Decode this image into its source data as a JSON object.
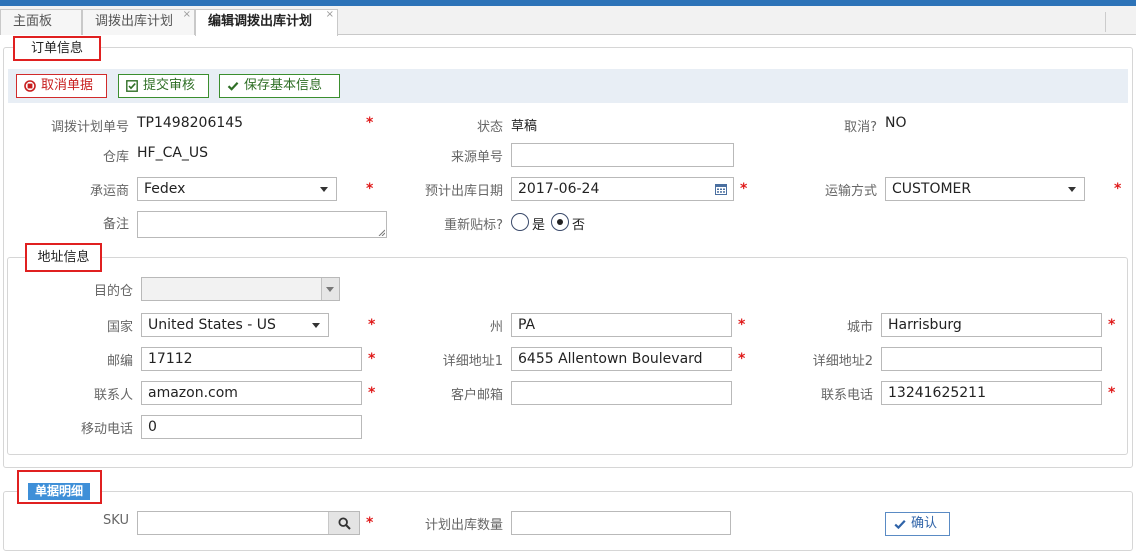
{
  "tabs": [
    {
      "label": "主面板"
    },
    {
      "label": "调拨出库计划",
      "close": "×"
    },
    {
      "label": "编辑调拨出库计划",
      "close": "×"
    }
  ],
  "order_section": {
    "legend": "订单信息",
    "buttons": {
      "cancel": "取消单据",
      "submit": "提交审核",
      "save": "保存基本信息"
    },
    "fields": {
      "plan_no_label": "调拨计划单号",
      "plan_no_value": "TP1498206145",
      "status_label": "状态",
      "status_value": "草稿",
      "cancelled_label": "取消?",
      "cancelled_value": "NO",
      "warehouse_label": "仓库",
      "warehouse_value": "HF_CA_US",
      "source_no_label": "来源单号",
      "source_no_value": "",
      "carrier_label": "承运商",
      "carrier_value": "Fedex",
      "ship_date_label": "预计出库日期",
      "ship_date_value": "2017-06-24",
      "transport_label": "运输方式",
      "transport_value": "CUSTOMER",
      "remark_label": "备注",
      "relabel_label": "重新贴标?",
      "relabel_yes": "是",
      "relabel_no": "否",
      "relabel_selected": "否"
    },
    "required_mark": "*"
  },
  "address_section": {
    "legend": "地址信息",
    "fields": {
      "dest_wh_label": "目的仓",
      "dest_wh_value": "",
      "country_label": "国家",
      "country_value": "United States - US",
      "state_label": "州",
      "state_value": "PA",
      "city_label": "城市",
      "city_value": "Harrisburg",
      "zip_label": "邮编",
      "zip_value": "17112",
      "addr1_label": "详细地址1",
      "addr1_value": "6455 Allentown Boulevard",
      "addr2_label": "详细地址2",
      "addr2_value": "",
      "contact_label": "联系人",
      "contact_value": "amazon.com",
      "email_label": "客户邮箱",
      "email_value": "",
      "phone_label": "联系电话",
      "phone_value": "13241625211",
      "mobile_label": "移动电话",
      "mobile_value": "0"
    }
  },
  "detail_section": {
    "legend": "单据明细",
    "sku_label": "SKU",
    "sku_value": "",
    "qty_label": "计划出库数量",
    "qty_value": "",
    "confirm_label": "确认"
  },
  "colors": {
    "accent": "#2d73b8",
    "required": "#e01b1b",
    "highlight_border": "#e02020"
  }
}
